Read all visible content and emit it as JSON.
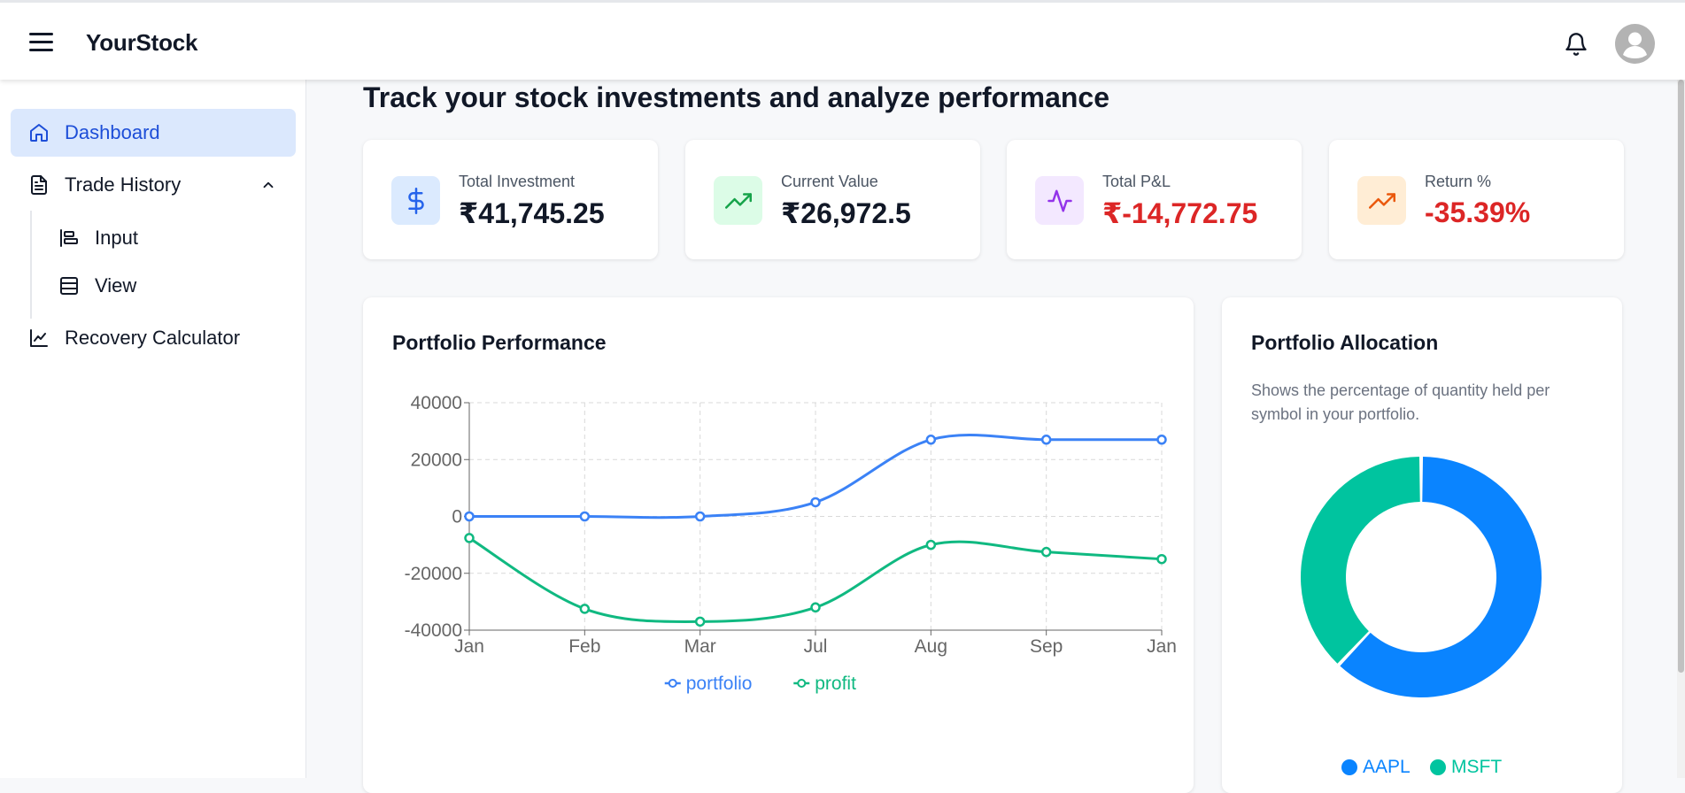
{
  "app": {
    "brand": "YourStock"
  },
  "topbar": {
    "menu_icon": "hamburger-icon",
    "notification_icon": "bell-icon",
    "avatar_icon": "user-icon"
  },
  "sidebar": {
    "items": [
      {
        "label": "Dashboard",
        "icon": "home-icon",
        "active": true
      },
      {
        "label": "Trade History",
        "icon": "document-icon",
        "expanded": true,
        "children": [
          {
            "label": "Input",
            "icon": "input-icon"
          },
          {
            "label": "View",
            "icon": "table-icon"
          }
        ]
      },
      {
        "label": "Recovery Calculator",
        "icon": "line-chart-icon"
      }
    ]
  },
  "main": {
    "headline": "Track your stock investments and analyze performance"
  },
  "stats": [
    {
      "label": "Total Investment",
      "value": "₹41,745.25",
      "icon": "dollar-icon",
      "accent": "#2563eb",
      "bg": "#dbeafe",
      "negative": false
    },
    {
      "label": "Current Value",
      "value": "₹26,972.5",
      "icon": "trending-up-icon",
      "accent": "#16a34a",
      "bg": "#dcfce7",
      "negative": false
    },
    {
      "label": "Total P&L",
      "value": "₹-14,772.75",
      "icon": "activity-icon",
      "accent": "#9333ea",
      "bg": "#f3e8ff",
      "negative": true
    },
    {
      "label": "Return %",
      "value": "-35.39%",
      "icon": "trending-up-icon",
      "accent": "#ea580c",
      "bg": "#ffedd5",
      "negative": true
    }
  ],
  "performance": {
    "title": "Portfolio Performance",
    "chart_data": {
      "type": "line",
      "categories": [
        "Jan",
        "Feb",
        "Mar",
        "Jul",
        "Aug",
        "Sep",
        "Jan"
      ],
      "series": [
        {
          "name": "portfolio",
          "color": "#3b82f6",
          "values": [
            0,
            0,
            0,
            5000,
            27000,
            27000,
            27000
          ]
        },
        {
          "name": "profit",
          "color": "#10b981",
          "values": [
            -7600,
            -32500,
            -37000,
            -32000,
            -10000,
            -12500,
            -15000
          ]
        }
      ],
      "ylim": [
        -40000,
        40000
      ],
      "yticks": [
        40000,
        20000,
        0,
        -20000,
        -40000
      ],
      "grid": true,
      "legend": "bottom"
    }
  },
  "allocation": {
    "title": "Portfolio Allocation",
    "description": "Shows the percentage of quantity held per symbol in your portfolio.",
    "chart_data": {
      "type": "pie",
      "donut": true,
      "labels": [
        "AAPL",
        "MSFT"
      ],
      "values": [
        62,
        38
      ],
      "colors": [
        "#0a84ff",
        "#00c49f"
      ],
      "legend": "bottom"
    }
  }
}
